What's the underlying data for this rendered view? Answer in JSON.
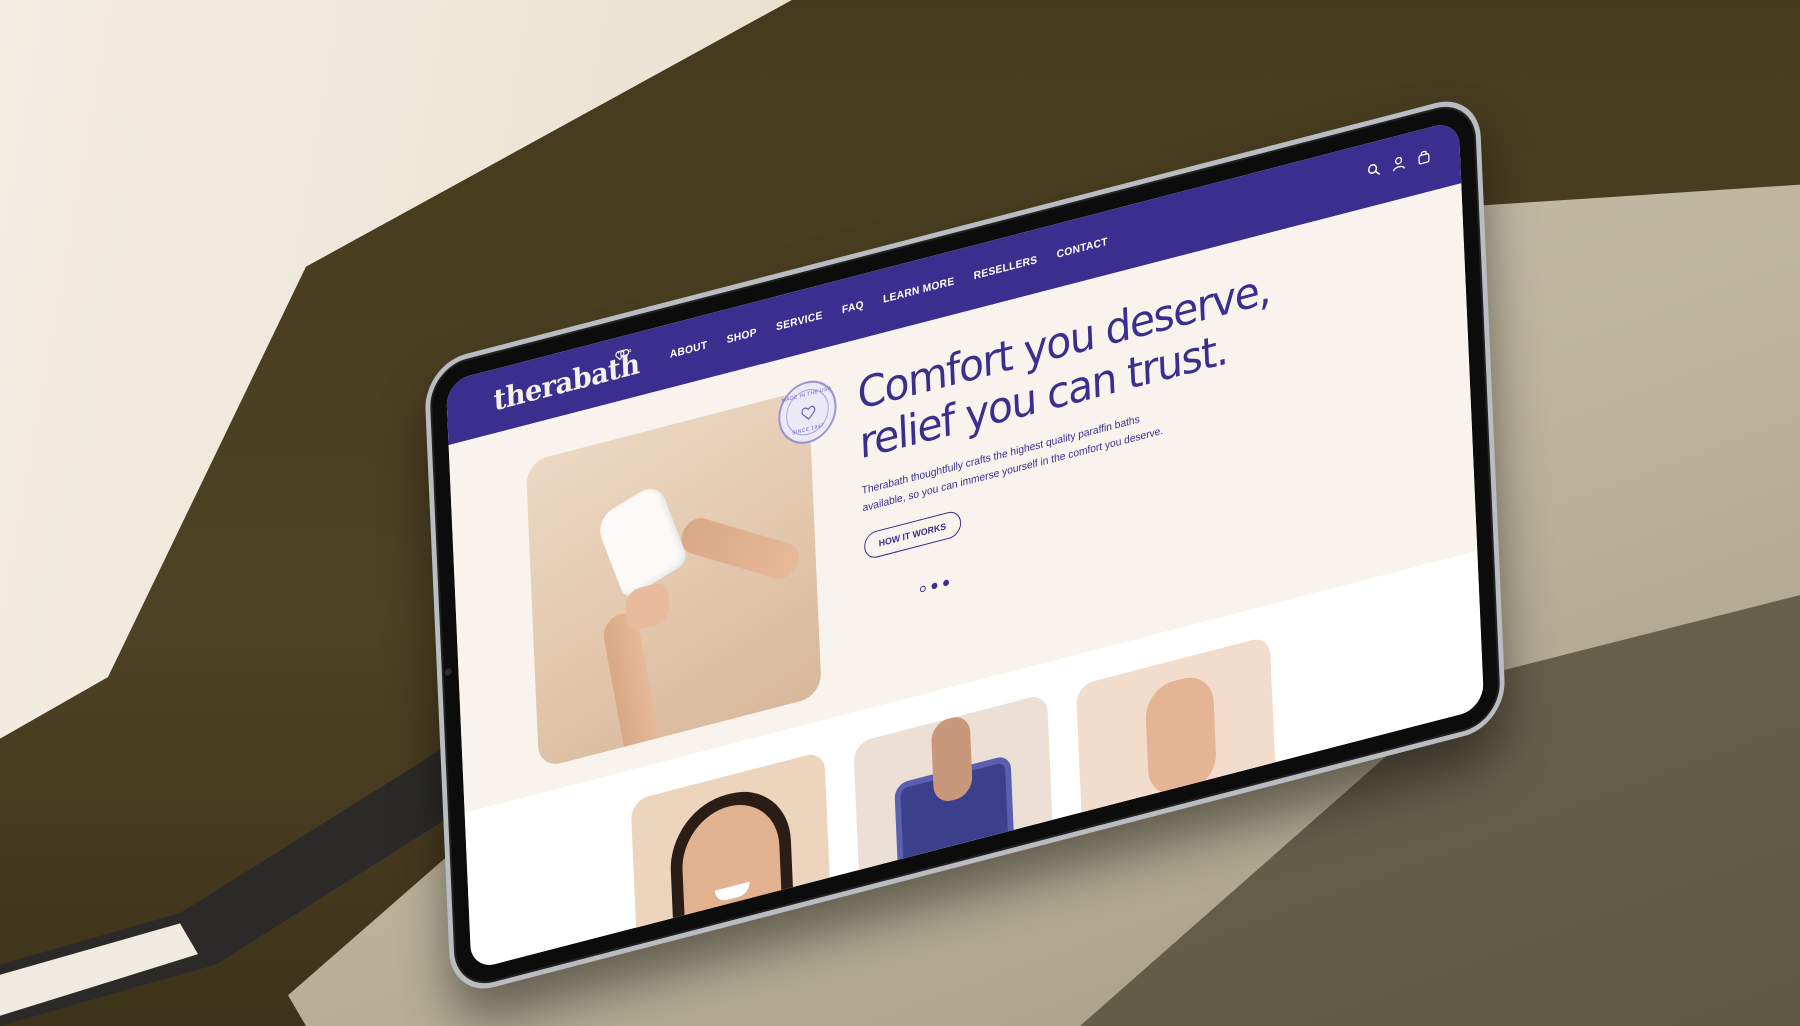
{
  "brand": {
    "logo_text": "therabath",
    "primary_color": "#3a2f8f",
    "background_color": "#f8f4ed"
  },
  "nav": {
    "items": [
      {
        "label": "ABOUT"
      },
      {
        "label": "SHOP"
      },
      {
        "label": "SERVICE"
      },
      {
        "label": "FAQ"
      },
      {
        "label": "LEARN MORE"
      },
      {
        "label": "RESELLERS"
      },
      {
        "label": "CONTACT"
      }
    ],
    "icons": [
      "search-icon",
      "user-icon",
      "cart-icon"
    ]
  },
  "hero": {
    "title": "Comfort you deserve, relief you can trust.",
    "description": "Therabath thoughtfully crafts the highest quality paraffin baths available, so you can immerse yourself in the comfort you deserve.",
    "cta_label": "HOW IT WORKS",
    "badge": {
      "top_text": "MADE IN THE USA",
      "bottom_text": "SINCE 1947"
    },
    "carousel": {
      "slide_count": 3,
      "active_index": 0
    }
  }
}
